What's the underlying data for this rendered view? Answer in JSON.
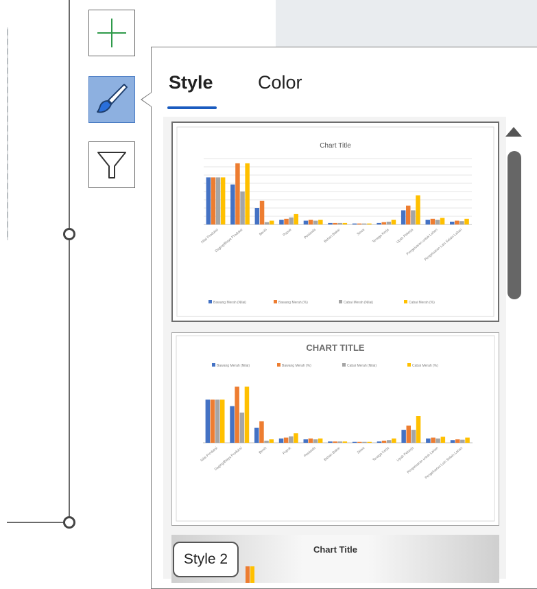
{
  "tabs": [
    {
      "label": "Style",
      "active": true
    },
    {
      "label": "Color",
      "active": false
    }
  ],
  "tools": [
    {
      "name": "chart-elements",
      "icon": "plus-icon"
    },
    {
      "name": "chart-styles",
      "icon": "paintbrush-icon",
      "active": true
    },
    {
      "name": "chart-filters",
      "icon": "funnel-icon"
    }
  ],
  "tooltip": "Style 2",
  "style_thumbnails": [
    {
      "title": "Chart Title",
      "selected": true
    },
    {
      "title": "CHART TITLE",
      "selected": false
    },
    {
      "title": "Chart Title",
      "selected": false
    }
  ],
  "colors": {
    "accent": "#1a5bbf",
    "series": [
      "#4472c4",
      "#ed7d31",
      "#a5a5a5",
      "#ffc000"
    ],
    "active_tool_bg": "#8db0e0"
  },
  "chart_data": {
    "type": "bar",
    "title": "Chart Title",
    "categories": [
      "Nilai Produksi",
      "Daging/Biaya Produksi",
      "Benih",
      "Pupuk",
      "Pestisida",
      "Bahan Bakar",
      "Sewa",
      "Tenaga Kerja",
      "Upah Pekerja",
      "Pengeluaran untuk Lahan",
      "Pengeluaran Lain Selain Lahan"
    ],
    "series": [
      {
        "name": "Bawang Merah (Nilai)",
        "values": [
          100,
          85,
          35,
          10,
          8,
          3,
          2,
          3,
          30,
          10,
          6
        ]
      },
      {
        "name": "Bawang Merah (%)",
        "values": [
          100,
          130,
          50,
          12,
          10,
          3,
          2,
          5,
          40,
          12,
          8
        ]
      },
      {
        "name": "Cabai Merah (Nilai)",
        "values": [
          100,
          70,
          5,
          15,
          8,
          3,
          2,
          6,
          30,
          10,
          7
        ]
      },
      {
        "name": "Cabai Merah (%)",
        "values": [
          100,
          130,
          8,
          22,
          10,
          3,
          2,
          10,
          62,
          14,
          12
        ]
      }
    ],
    "ylim": [
      0,
      140
    ],
    "legend": "bottom"
  }
}
